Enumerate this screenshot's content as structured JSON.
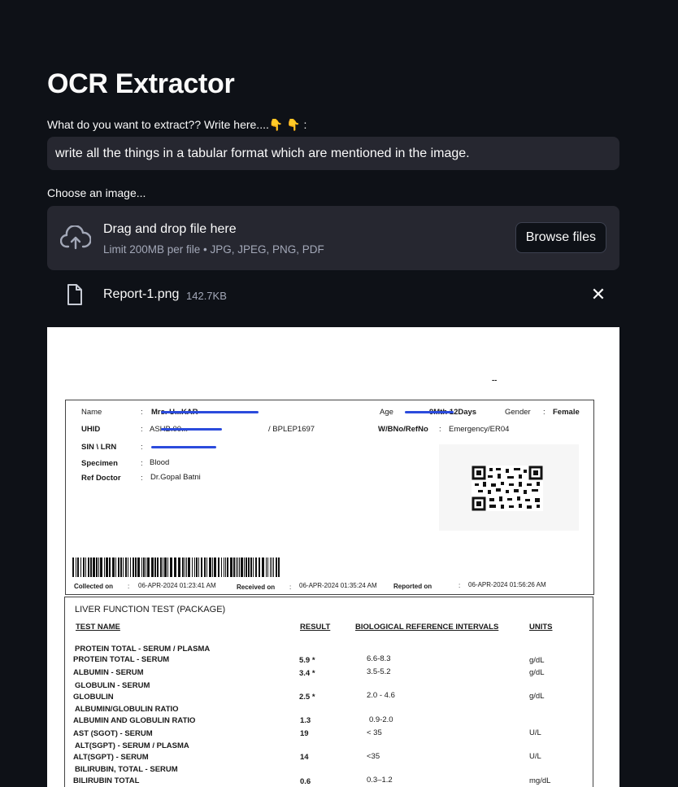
{
  "app": {
    "title": "OCR Extractor"
  },
  "prompt": {
    "label": "What do you want to extract?? Write here....👇 👇 :",
    "value": "write all the things in a tabular format which are mentioned in the image."
  },
  "uploader": {
    "label": "Choose an image...",
    "drag_text": "Drag and drop file here",
    "limit_text": "Limit 200MB per file • JPG, JPEG, PNG, PDF",
    "browse_label": "Browse files",
    "icon": "cloud-upload-icon"
  },
  "file": {
    "name": "Report-1.png",
    "size": "142.7KB",
    "icon": "file-icon",
    "remove_icon": "close-icon",
    "remove_glyph": "✕"
  },
  "report": {
    "dash": "--",
    "header": {
      "name_label": "Name",
      "name_value": "Mrs. U...KAR",
      "uhid_label": "UHID",
      "uhid_value": "ASHB.00...",
      "uhid_suffix": "/ BPLEP1697",
      "sin_label": "SIN \\ LRN",
      "sin_value": "",
      "specimen_label": "Specimen",
      "specimen_value": "Blood",
      "ref_label": "Ref Doctor",
      "ref_value": "Dr.Gopal  Batni",
      "age_label": "Age",
      "age_value": "9Mth 12Days",
      "gender_label": "Gender",
      "gender_value": "Female",
      "wb_label": "W/BNo/RefNo",
      "wb_value": "Emergency/ER04",
      "collected_label": "Collected on",
      "collected_value": "06-APR-2024 01:23:41 AM",
      "received_label": "Received on",
      "received_value": "06-APR-2024 01:35:24 AM",
      "reported_label": "Reported on",
      "reported_value": "06-APR-2024 01:56:26 AM"
    },
    "section_title": "LIVER FUNCTION TEST (PACKAGE)",
    "columns": [
      "TEST NAME",
      "RESULT",
      "BIOLOGICAL REFERENCE INTERVALS",
      "UNITS"
    ],
    "groups": [
      "PROTEIN TOTAL - SERUM / PLASMA",
      "GLOBULIN - SERUM",
      "ALBUMIN/GLOBULIN RATIO",
      "ALT(SGPT) - SERUM / PLASMA",
      "BILIRUBIN, TOTAL - SERUM"
    ],
    "rows": [
      {
        "name": "PROTEIN TOTAL - SERUM",
        "result": "5.9 *",
        "range": "6.6-8.3",
        "unit": "g/dL"
      },
      {
        "name": "ALBUMIN - SERUM",
        "result": "3.4 *",
        "range": "3.5-5.2",
        "unit": "g/dL"
      },
      {
        "name": "GLOBULIN",
        "result": "2.5 *",
        "range": "2.0 - 4.6",
        "unit": "g/dL"
      },
      {
        "name": "ALBUMIN AND GLOBULIN RATIO",
        "result": "1.3",
        "range": "0.9-2.0",
        "unit": ""
      },
      {
        "name": "AST (SGOT) - SERUM",
        "result": "19",
        "range": "< 35",
        "unit": "U/L"
      },
      {
        "name": "ALT(SGPT) - SERUM",
        "result": "14",
        "range": "<35",
        "unit": "U/L"
      },
      {
        "name": "BILIRUBIN TOTAL",
        "result": "0.6",
        "range": "0.3–1.2",
        "unit": "mg/dL"
      }
    ]
  }
}
